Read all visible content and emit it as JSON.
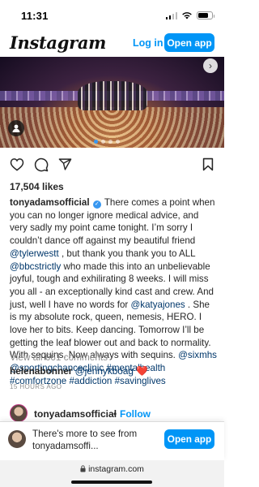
{
  "status_bar": {
    "time": "11:31"
  },
  "header": {
    "logo": "Instagram",
    "login_label": "Log in",
    "open_app_label": "Open app"
  },
  "media": {
    "carousel_count": 4,
    "active_index": 0
  },
  "post": {
    "likes": "17,504 likes",
    "author": "tonyadamsofficial",
    "caption_parts": [
      "There comes a point when you can no longer ignore medical advice, and very sadly my point came tonight. I’m sorry I couldn’t dance off against my beautiful friend ",
      " , but thank you thank you to ALL ",
      " who made this into an unbelievable joyful, tough and exhilirating 8 weeks. I will miss you all - an exceptionally kind cast and crew. And just, well I have no words for ",
      " . She is my absolute rock, queen, nemesis, HERO. I love her to bits. Keep dancing. Tomorrow I’ll be getting the leaf blower out and back to normality. With sequins. Now always with sequins. "
    ],
    "mentions": [
      "@tylerwestt",
      "@bbcstrictly",
      "@katyajones",
      "@sixmhs",
      "@sportingchanceclinic"
    ],
    "hashtags": [
      "#mentalhealth",
      "#comfortzone",
      "#addiction",
      "#savinglives"
    ],
    "view_comments": "View all 661 comments",
    "comment": {
      "user": "helenabonner",
      "mention": "@jennykboag",
      "emoji": "❤️"
    },
    "timestamp": "15 HOURS AGO"
  },
  "next_post": {
    "username": "tonyadamsofficial",
    "separator": "•",
    "follow_label": "Follow"
  },
  "banner": {
    "line1": "There's more to see from",
    "line2": "tonyadamsoffi...",
    "button_label": "Open app"
  },
  "browser": {
    "url": "instagram.com"
  },
  "colors": {
    "accent": "#0095f6",
    "link": "#00376b",
    "muted": "#8e8e8e",
    "heart": "#ed4956"
  }
}
